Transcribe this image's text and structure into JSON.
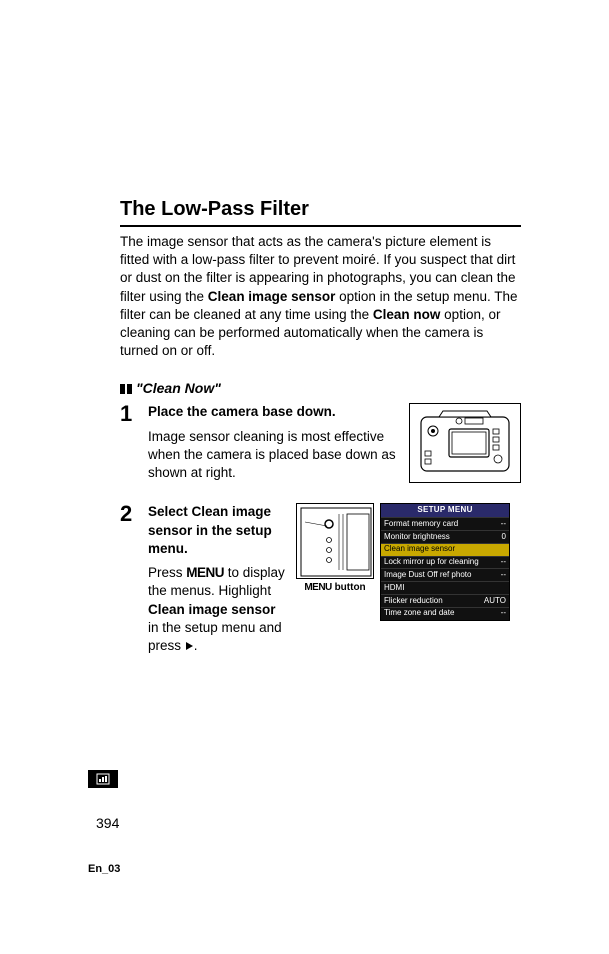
{
  "title": "The Low-Pass Filter",
  "intro_pre": "The image sensor that acts as the camera's picture element is fitted with a low-pass filter to prevent moiré.  If you suspect that dirt or dust on the filter is appearing in photographs, you can clean the filter using the ",
  "intro_b1": "Clean image sensor",
  "intro_mid": " option in the setup menu.  The filter can be cleaned at any time using the ",
  "intro_b2": "Clean now",
  "intro_post": " option, or cleaning can be performed automatically when the camera is turned on or off.",
  "subhead": "\"Clean Now\"",
  "step1": {
    "num": "1",
    "head": "Place the camera base down.",
    "text": "Image sensor cleaning is most effective when the camera is placed base down as shown at right."
  },
  "step2": {
    "num": "2",
    "head_pre": "Select ",
    "head_b": "Clean image sensor",
    "head_post": " in the setup menu.",
    "text_pre": "Press ",
    "menu_word": "MENU",
    "text_mid": " to display the menus.  Highlight ",
    "text_b": "Clean image sensor",
    "text_post": " in the setup menu and press ",
    "caption_pre": "MENU",
    "caption_post": " button"
  },
  "setup_menu": {
    "header": "SETUP MENU",
    "rows": [
      {
        "label": "Format memory card",
        "value": "--"
      },
      {
        "label": "Monitor brightness",
        "value": "0"
      },
      {
        "label": "Clean image sensor",
        "value": "",
        "highlight": true
      },
      {
        "label": "Lock mirror up for cleaning",
        "value": "--"
      },
      {
        "label": "Image Dust Off ref photo",
        "value": "--"
      },
      {
        "label": "HDMI",
        "value": ""
      },
      {
        "label": "Flicker reduction",
        "value": "AUTO"
      },
      {
        "label": "Time zone and date",
        "value": "--"
      }
    ]
  },
  "page_number": "394",
  "doc_code": "En_03"
}
